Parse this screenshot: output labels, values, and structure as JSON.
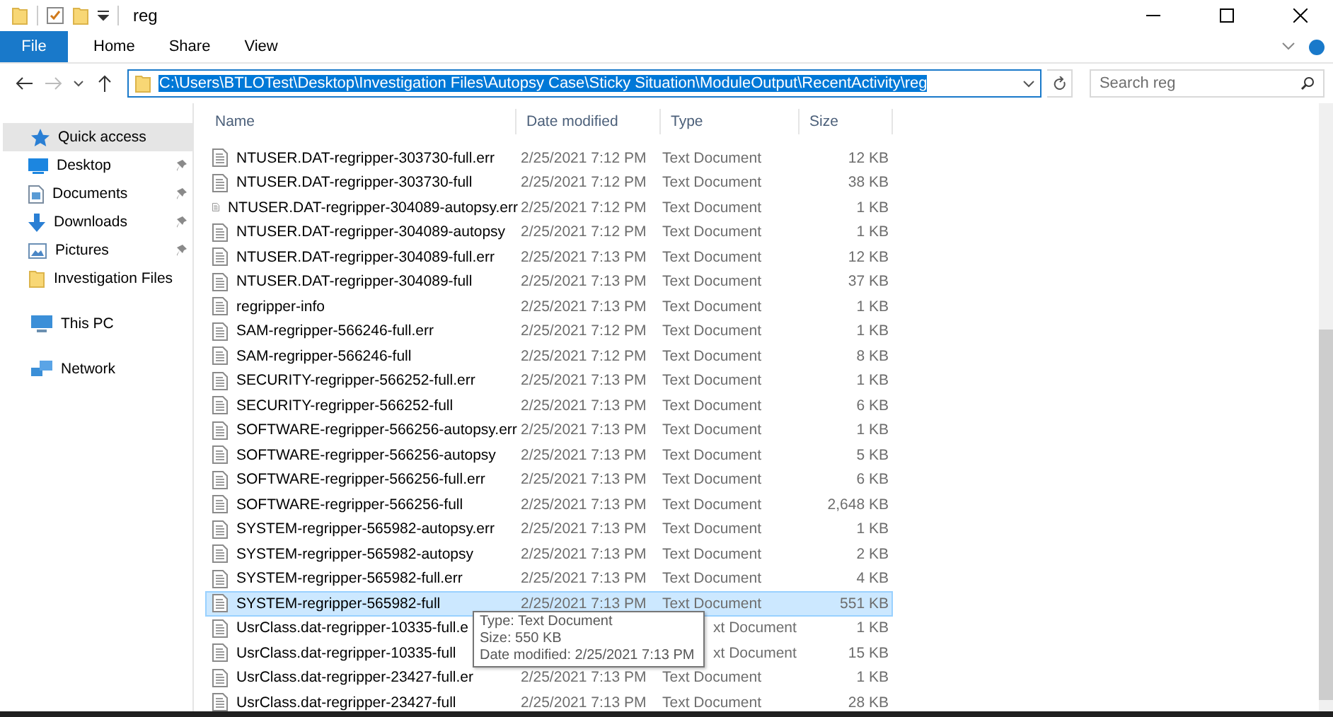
{
  "window": {
    "title": "reg"
  },
  "ribbon": {
    "tabs": [
      {
        "label": "File",
        "kind": "file"
      },
      {
        "label": "Home",
        "kind": "tab"
      },
      {
        "label": "Share",
        "kind": "tab"
      },
      {
        "label": "View",
        "kind": "tab"
      }
    ]
  },
  "address": {
    "path": "C:\\Users\\BTLOTest\\Desktop\\Investigation Files\\Autopsy Case\\Sticky Situation\\ModuleOutput\\RecentActivity\\reg",
    "selected": true
  },
  "search": {
    "placeholder": "Search reg"
  },
  "sidebar": {
    "items": [
      {
        "label": "Quick access",
        "kind": "star",
        "selected": true,
        "children": [
          {
            "label": "Desktop",
            "kind": "desktop",
            "pinned": true,
            "selected": false
          },
          {
            "label": "Documents",
            "kind": "documents",
            "pinned": true,
            "selected": false
          },
          {
            "label": "Downloads",
            "kind": "downloads",
            "pinned": true,
            "selected": false
          },
          {
            "label": "Pictures",
            "kind": "pictures",
            "pinned": true,
            "selected": false
          },
          {
            "label": "Investigation Files",
            "kind": "folder",
            "pinned": false,
            "selected": false
          }
        ]
      },
      {
        "label": "This PC",
        "kind": "pc",
        "selected": false
      },
      {
        "label": "Network",
        "kind": "network",
        "selected": false
      }
    ]
  },
  "table": {
    "columns": [
      "Name",
      "Date modified",
      "Type",
      "Size"
    ],
    "rows": [
      {
        "name": "NTUSER.DAT-regripper-303730-full.err",
        "date": "2/25/2021 7:12 PM",
        "type": "Text Document",
        "size": "12 KB",
        "selected": false
      },
      {
        "name": "NTUSER.DAT-regripper-303730-full",
        "date": "2/25/2021 7:12 PM",
        "type": "Text Document",
        "size": "38 KB",
        "selected": false
      },
      {
        "name": "NTUSER.DAT-regripper-304089-autopsy.err",
        "date": "2/25/2021 7:12 PM",
        "type": "Text Document",
        "size": "1 KB",
        "selected": false
      },
      {
        "name": "NTUSER.DAT-regripper-304089-autopsy",
        "date": "2/25/2021 7:12 PM",
        "type": "Text Document",
        "size": "1 KB",
        "selected": false
      },
      {
        "name": "NTUSER.DAT-regripper-304089-full.err",
        "date": "2/25/2021 7:13 PM",
        "type": "Text Document",
        "size": "12 KB",
        "selected": false
      },
      {
        "name": "NTUSER.DAT-regripper-304089-full",
        "date": "2/25/2021 7:13 PM",
        "type": "Text Document",
        "size": "37 KB",
        "selected": false
      },
      {
        "name": "regripper-info",
        "date": "2/25/2021 7:13 PM",
        "type": "Text Document",
        "size": "1 KB",
        "selected": false
      },
      {
        "name": "SAM-regripper-566246-full.err",
        "date": "2/25/2021 7:12 PM",
        "type": "Text Document",
        "size": "1 KB",
        "selected": false
      },
      {
        "name": "SAM-regripper-566246-full",
        "date": "2/25/2021 7:12 PM",
        "type": "Text Document",
        "size": "8 KB",
        "selected": false
      },
      {
        "name": "SECURITY-regripper-566252-full.err",
        "date": "2/25/2021 7:13 PM",
        "type": "Text Document",
        "size": "1 KB",
        "selected": false
      },
      {
        "name": "SECURITY-regripper-566252-full",
        "date": "2/25/2021 7:13 PM",
        "type": "Text Document",
        "size": "6 KB",
        "selected": false
      },
      {
        "name": "SOFTWARE-regripper-566256-autopsy.err",
        "date": "2/25/2021 7:13 PM",
        "type": "Text Document",
        "size": "1 KB",
        "selected": false
      },
      {
        "name": "SOFTWARE-regripper-566256-autopsy",
        "date": "2/25/2021 7:13 PM",
        "type": "Text Document",
        "size": "5 KB",
        "selected": false
      },
      {
        "name": "SOFTWARE-regripper-566256-full.err",
        "date": "2/25/2021 7:13 PM",
        "type": "Text Document",
        "size": "6 KB",
        "selected": false
      },
      {
        "name": "SOFTWARE-regripper-566256-full",
        "date": "2/25/2021 7:13 PM",
        "type": "Text Document",
        "size": "2,648 KB",
        "selected": false
      },
      {
        "name": "SYSTEM-regripper-565982-autopsy.err",
        "date": "2/25/2021 7:13 PM",
        "type": "Text Document",
        "size": "1 KB",
        "selected": false
      },
      {
        "name": "SYSTEM-regripper-565982-autopsy",
        "date": "2/25/2021 7:13 PM",
        "type": "Text Document",
        "size": "2 KB",
        "selected": false
      },
      {
        "name": "SYSTEM-regripper-565982-full.err",
        "date": "2/25/2021 7:13 PM",
        "type": "Text Document",
        "size": "4 KB",
        "selected": false
      },
      {
        "name": "SYSTEM-regripper-565982-full",
        "date": "2/25/2021 7:13 PM",
        "type": "Text Document",
        "size": "551 KB",
        "selected": true
      },
      {
        "name": "UsrClass.dat-regripper-10335-full.e",
        "type": "xt Document",
        "size": "1 KB",
        "selected": false
      },
      {
        "name": "UsrClass.dat-regripper-10335-full",
        "type": "xt Document",
        "size": "15 KB",
        "selected": false
      },
      {
        "name": "UsrClass.dat-regripper-23427-full.er",
        "date": "2/25/2021 7:13 PM",
        "type": "Text Document",
        "size": "1 KB",
        "selected": false
      },
      {
        "name": "UsrClass.dat-regripper-23427-full",
        "date": "2/25/2021 7:13 PM",
        "type": "Text Document",
        "size": "28 KB",
        "selected": false
      }
    ]
  },
  "tooltip": {
    "lines": [
      "Type: Text Document",
      "Size: 550 KB",
      "Date modified: 2/25/2021 7:13 PM"
    ]
  }
}
